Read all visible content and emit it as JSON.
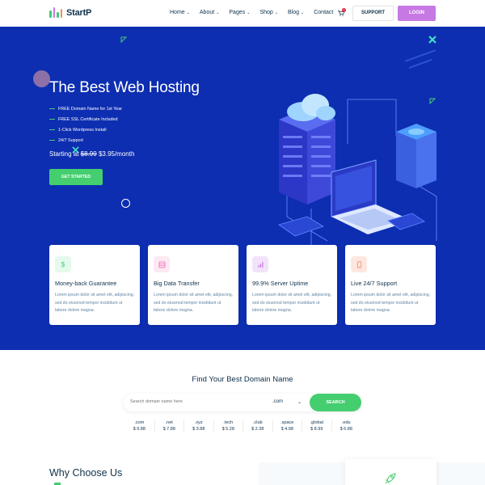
{
  "brand": {
    "name": "StartP"
  },
  "nav": {
    "items": [
      {
        "label": "Home",
        "dropdown": true
      },
      {
        "label": "About",
        "dropdown": true
      },
      {
        "label": "Pages",
        "dropdown": true
      },
      {
        "label": "Shop",
        "dropdown": true
      },
      {
        "label": "Blog",
        "dropdown": true
      },
      {
        "label": "Contact",
        "dropdown": false
      }
    ],
    "cart_count": "1",
    "support_label": "SUPPORT",
    "login_label": "LOGIN"
  },
  "hero": {
    "title": "The Best Web Hosting",
    "features": [
      "FREE Domain Name for 1st Year",
      "FREE SSL Certificate Included",
      "1-Click Wordpress Install",
      "24/7 Support"
    ],
    "price_prefix": "Starting at ",
    "price_old": "$8.99",
    "price_new": " $3.95/month",
    "cta_label": "GET STARTED"
  },
  "cards": [
    {
      "title": "Money-back Guarantee",
      "text": "Lorem ipsum dolor sit amet elit, adipiscing, sed do eiusmod tempor incididunt ut labore dolore magna.",
      "icon": "dollar-icon",
      "icon_bg": "#e5f9ec",
      "icon_color": "#44ce6f"
    },
    {
      "title": "Big Data Transfer",
      "text": "Lorem ipsum dolor sit amet elit, adipiscing, sed do eiusmod tempor incididunt ut labore dolore magna.",
      "icon": "server-icon",
      "icon_bg": "#fde9f3",
      "icon_color": "#f069b3"
    },
    {
      "title": "99.9% Server Uptime",
      "text": "Lorem ipsum dolor sit amet elit, adipiscing, sed do eiusmod tempor incididunt ut labore dolore magna.",
      "icon": "chart-icon",
      "icon_bg": "#f2e3fa",
      "icon_color": "#c679e3"
    },
    {
      "title": "Live 24/7 Support",
      "text": "Lorem ipsum dolor sit amet elit, adipiscing, sed do eiusmod tempor incididunt ut labore dolore magna.",
      "icon": "phone-icon",
      "icon_bg": "#fde8e0",
      "icon_color": "#f78a63"
    }
  ],
  "domain": {
    "title": "Find Your Best Domain Name",
    "placeholder": "Search domain name here",
    "selected_tld": ".com",
    "search_label": "SEARCH",
    "tlds": [
      {
        "name": ".com",
        "price": "$ 9.88"
      },
      {
        "name": ".net",
        "price": "$ 7.88"
      },
      {
        "name": ".xyz",
        "price": "$ 3.88"
      },
      {
        "name": ".tech",
        "price": "$ 5.28"
      },
      {
        "name": ".club",
        "price": "$ 2.38"
      },
      {
        "name": ".space",
        "price": "$ 4.98"
      },
      {
        "name": ".global",
        "price": "$ 8.99"
      },
      {
        "name": ".edu",
        "price": "$ 6.88"
      }
    ]
  },
  "why": {
    "title": "Why Choose Us"
  },
  "colors": {
    "primary": "#0d2eb0",
    "green": "#44ce6f",
    "purple": "#c679e3",
    "dark": "#0e314c"
  }
}
